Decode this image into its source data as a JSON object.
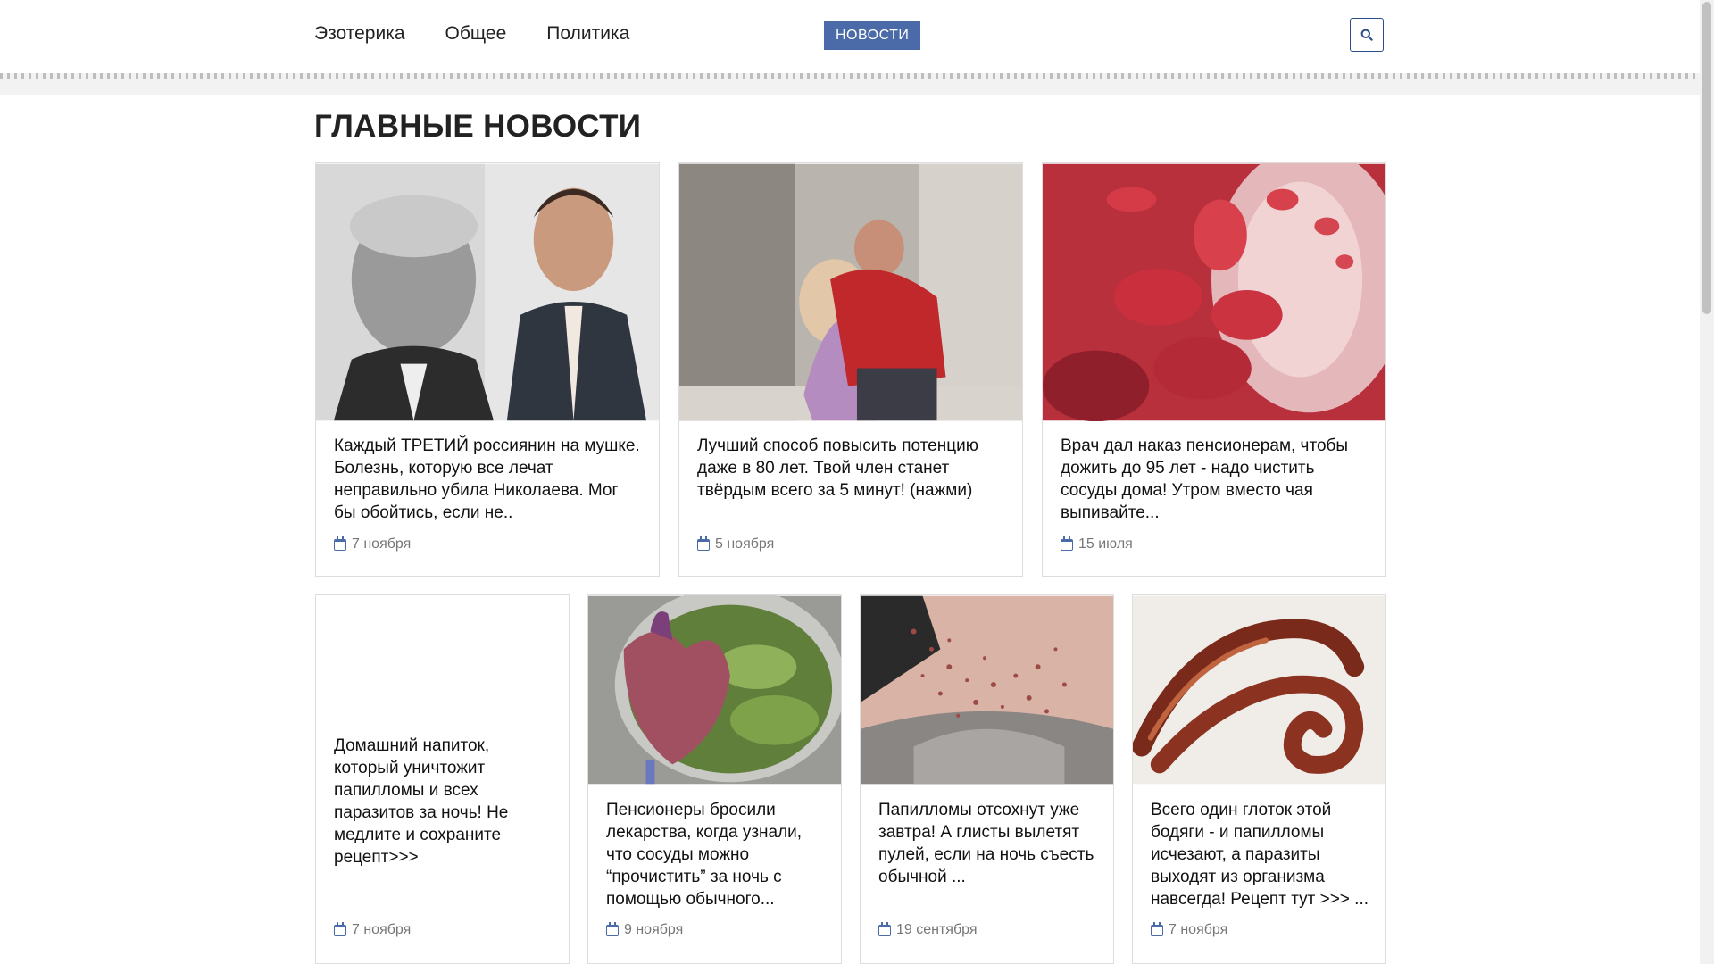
{
  "nav": {
    "items": [
      "Эзотерика",
      "Общее",
      "Политика"
    ],
    "badge": "НОВОСТИ"
  },
  "main": {
    "heading": "ГЛАВНЫЕ НОВОСТИ"
  },
  "cards_top": [
    {
      "title": "Каждый ТРЕТИЙ россиянин на мушке. Болезнь, которую все лечат неправильно убила Николаева. Мог бы обойтись, если не..",
      "date": "7 ноября"
    },
    {
      "title": "Лучший способ повысить потенцию даже в 80 лет. Твой член станет твёрдым всего за 5 минут! (нажми)",
      "date": "5 ноября"
    },
    {
      "title": "Врач дал наказ пенсионерам, чтобы дожить до 95 лет - надо чистить сосуды дома! Утром вместо чая выпивайте...",
      "date": "15 июля"
    }
  ],
  "cards_bottom": [
    {
      "title": "Домашний напиток, который уничтожит папилломы и всех паразитов за ночь! Не медлите и сохраните рецепт>>>",
      "date": "7 ноября"
    },
    {
      "title": "Пенсионеры бросили лекарства, когда узнали, что сосуды можно “прочистить” за ночь с помощью обычного...",
      "date": "9 ноября"
    },
    {
      "title": "Папилломы отсохнут уже завтра! А глисты вылетят пулей, если на ночь съесть обычной ...",
      "date": "19 сентября"
    },
    {
      "title": "Всего один глоток этой бодяги - и папилломы исчезают, а паразиты выходят из организма навсегда! Рецепт тут >>> ...",
      "date": "7 ноября"
    }
  ],
  "colors": {
    "accent": "#4a6aa8"
  }
}
